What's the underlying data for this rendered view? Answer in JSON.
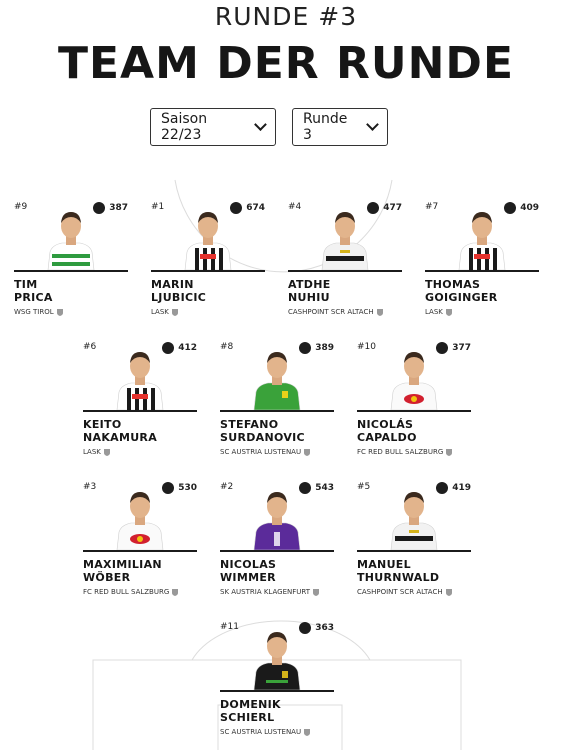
{
  "header": {
    "pre_title": "RUNDE #3",
    "title": "TEAM DER RUNDE"
  },
  "filters": {
    "season": "Saison 22/23",
    "round": "Runde 3"
  },
  "players": [
    {
      "number": "#9",
      "points": "387",
      "first": "TIM",
      "last": "PRICA",
      "club": "WSG TIROL",
      "shirt": "green-hoops",
      "club_icon": "wsg-crest-icon"
    },
    {
      "number": "#1",
      "points": "674",
      "first": "MARIN",
      "last": "LJUBICIC",
      "club": "LASK",
      "shirt": "black-white-stripes",
      "club_icon": "lask-crest-icon"
    },
    {
      "number": "#4",
      "points": "477",
      "first": "ATDHE",
      "last": "NUHIU",
      "club": "CASHPOINT SCR ALTACH",
      "shirt": "white-black",
      "club_icon": "altach-crest-icon"
    },
    {
      "number": "#7",
      "points": "409",
      "first": "THOMAS",
      "last": "GOIGINGER",
      "club": "LASK",
      "shirt": "black-white-stripes",
      "club_icon": "lask-crest-icon"
    },
    {
      "number": "#6",
      "points": "412",
      "first": "KEITO",
      "last": "NAKAMURA",
      "club": "LASK",
      "shirt": "black-white-stripes",
      "club_icon": "lask-crest-icon"
    },
    {
      "number": "#8",
      "points": "389",
      "first": "STEFANO",
      "last": "SURDANOVIC",
      "club": "SC AUSTRIA LUSTENAU",
      "shirt": "green",
      "club_icon": "lustenau-crest-icon"
    },
    {
      "number": "#10",
      "points": "377",
      "first": "NICOLÁS",
      "last": "CAPALDO",
      "club": "FC RED BULL SALZBURG",
      "shirt": "white-red",
      "club_icon": "salzburg-crest-icon"
    },
    {
      "number": "#3",
      "points": "530",
      "first": "MAXIMILIAN",
      "last": "WÖBER",
      "club": "FC RED BULL SALZBURG",
      "shirt": "white-red",
      "club_icon": "salzburg-crest-icon"
    },
    {
      "number": "#2",
      "points": "543",
      "first": "NICOLAS",
      "last": "WIMMER",
      "club": "SK AUSTRIA KLAGENFURT",
      "shirt": "purple",
      "club_icon": "klagenfurt-crest-icon"
    },
    {
      "number": "#5",
      "points": "419",
      "first": "MANUEL",
      "last": "THURNWALD",
      "club": "CASHPOINT SCR ALTACH",
      "shirt": "white-black",
      "club_icon": "altach-crest-icon"
    },
    {
      "number": "#11",
      "points": "363",
      "first": "DOMENIK",
      "last": "SCHIERL",
      "club": "SC AUSTRIA LUSTENAU",
      "shirt": "black-gold",
      "club_icon": "lustenau-crest-icon"
    }
  ],
  "colors": {
    "pitch_lines": "#dcdcdc",
    "text": "#1b1b1b",
    "badge": "#1e1e1e"
  }
}
